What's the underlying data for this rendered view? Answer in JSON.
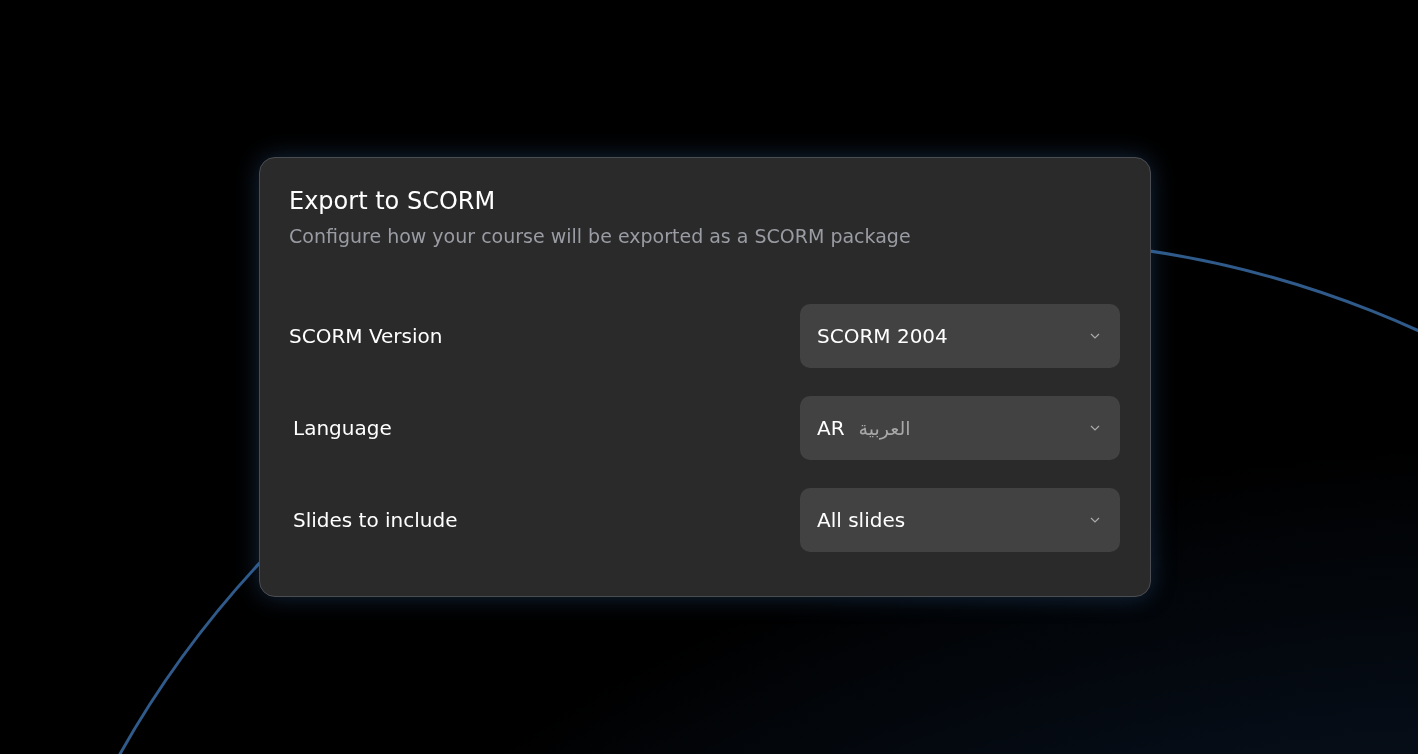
{
  "dialog": {
    "title": "Export to SCORM",
    "description": "Configure how your course will be exported as a SCORM package",
    "fields": [
      {
        "label": "SCORM Version",
        "value": "SCORM 2004"
      },
      {
        "label": "Language",
        "value": "AR",
        "secondary": "العربية"
      },
      {
        "label": "Slides to include",
        "value": "All slides"
      }
    ]
  }
}
